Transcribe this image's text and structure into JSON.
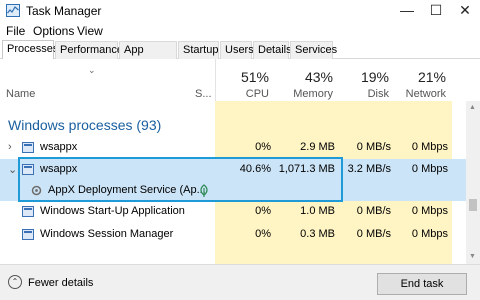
{
  "window": {
    "title": "Task Manager",
    "icon": "task-manager-icon",
    "controls": {
      "minimize": "—",
      "maximize": "☐",
      "close": "✕"
    }
  },
  "menu": [
    "File",
    "Options",
    "View"
  ],
  "tabs": [
    "Processes",
    "Performance",
    "App history",
    "Startup",
    "Users",
    "Details",
    "Services"
  ],
  "active_tab": "Processes",
  "columns": {
    "name": "Name",
    "status": "S...",
    "cpu": {
      "pct": "51%",
      "label": "CPU"
    },
    "memory": {
      "pct": "43%",
      "label": "Memory"
    },
    "disk": {
      "pct": "19%",
      "label": "Disk"
    },
    "network": {
      "pct": "21%",
      "label": "Network"
    }
  },
  "group": {
    "title": "Windows processes (93)"
  },
  "rows": [
    {
      "expand": "›",
      "name": "wsappx",
      "cpu": "0%",
      "memory": "2.9 MB",
      "disk": "0 MB/s",
      "network": "0 Mbps"
    },
    {
      "expand": "⌄",
      "name": "wsappx",
      "cpu": "40.6%",
      "memory": "1,071.3 MB",
      "disk": "3.2 MB/s",
      "network": "0 Mbps"
    },
    {
      "name": "AppX Deployment Service (Ap...",
      "leaf_icon": "leaf-icon"
    },
    {
      "name": "Windows Start-Up Application",
      "cpu": "0%",
      "memory": "1.0 MB",
      "disk": "0 MB/s",
      "network": "0 Mbps"
    },
    {
      "name": "Windows Session Manager",
      "cpu": "0%",
      "memory": "0.3 MB",
      "disk": "0 MB/s",
      "network": "0 Mbps"
    }
  ],
  "footer": {
    "fewer_details": "Fewer details",
    "end_task": "End task"
  },
  "colors": {
    "accent": "#1e9ad6",
    "group_title": "#1a5fa0",
    "usage_fill": "#fff4c4",
    "selection": "#cce4f7"
  }
}
